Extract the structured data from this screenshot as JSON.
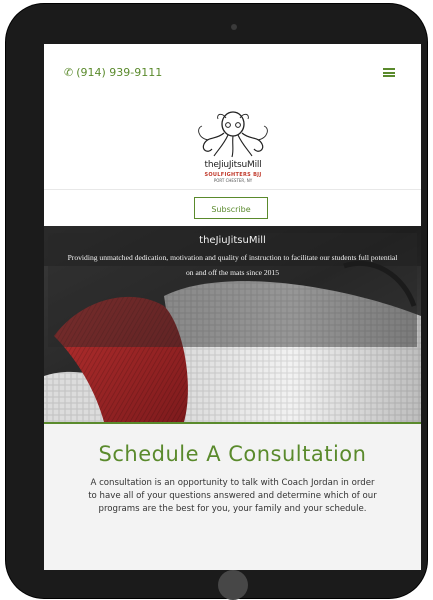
{
  "header": {
    "phone": "(914) 939-9111",
    "phone_icon": "phone-icon",
    "menu_icon": "hamburger-menu-icon"
  },
  "logo": {
    "name": "theJiuJitsuMill",
    "tagline": "SOULFIGHTERS BJJ",
    "location": "PORT CHESTER, NY"
  },
  "subscribe": {
    "label": "Subscribe"
  },
  "hero": {
    "title": "theJiuJitsuMill",
    "text": "Providing unmatched dedication, motivation and quality of instruction to facilitate our students full potential on and off the mats since 2015"
  },
  "consultation": {
    "title": "Schedule A Consultation",
    "text": "A consultation is an opportunity to talk with Coach Jordan in order to have all of your questions answered and determine which of our programs are the best for you, your family and your schedule."
  },
  "colors": {
    "accent": "#5a8a2c",
    "device": "#1b1b1b",
    "section_bg": "#f3f3f3"
  }
}
